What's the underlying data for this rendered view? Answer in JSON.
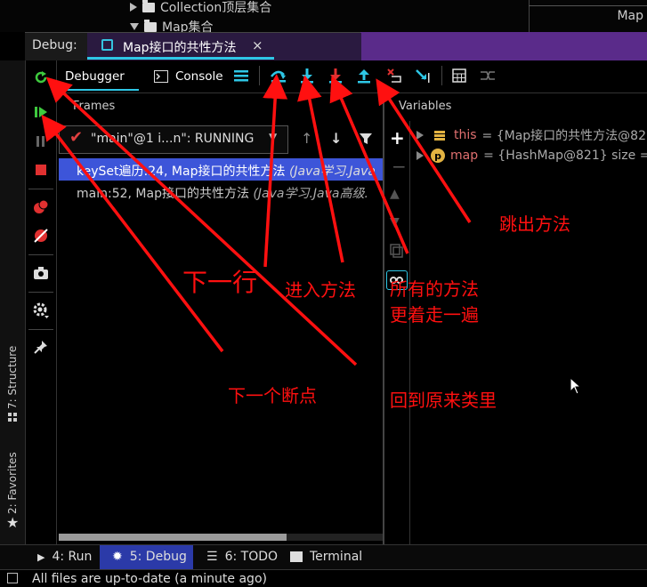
{
  "project_tree": {
    "row1": "Collection顶层集合",
    "row2": "Map集合",
    "right_tab": "Map"
  },
  "debug_window": {
    "label": "Debug:",
    "tab_title": "Map接口的共性方法",
    "close_glyph": "×"
  },
  "toolbar": {
    "tab_debugger": "Debugger",
    "tab_console": "Console",
    "icons": [
      "show-execution-point",
      "step-over",
      "step-into",
      "force-step-into",
      "step-out",
      "drop-frame",
      "run-to-cursor",
      "evaluate-expression",
      "trace-current-stream"
    ]
  },
  "frames": {
    "title": "Frames",
    "thread": "\"main\"@1 i...n\": RUNNING",
    "items": [
      {
        "method": "keySet遍历:24, Map接口的共性方法",
        "location": "(Java学习.Java"
      },
      {
        "method": "main:52, Map接口的共性方法",
        "location": "(Java学习.Java高级."
      }
    ]
  },
  "variables": {
    "title": "Variables",
    "items": [
      {
        "name": "this",
        "value": "= {Map接口的共性方法@82"
      },
      {
        "name": "map",
        "value": "= {HashMap@821}  size ="
      }
    ]
  },
  "side_tools": {
    "structure": "7: Structure",
    "favorites": "2: Favorites"
  },
  "bottom_tabs": {
    "run": "4: Run",
    "debug": "5: Debug",
    "todo": "6: TODO",
    "terminal": "Terminal"
  },
  "status": "All files are up-to-date (a minute ago)",
  "annotations": {
    "next_line": "下一行",
    "step_into": "进入方法",
    "step_out": "跳出方法",
    "all_methods_1": "所有的方法",
    "all_methods_2": "更着走一遍",
    "next_breakpoint": "下一个断点",
    "back_to_class": "回到原来类里"
  },
  "colors": {
    "annotation_red": "#ff1010",
    "accent_cyan": "#2ec7e6",
    "selection_blue": "#3d55d9",
    "debug_purple": "#5a2b8a"
  }
}
